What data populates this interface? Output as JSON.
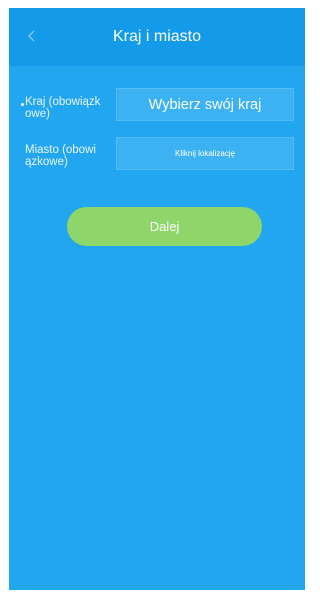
{
  "header": {
    "title": "Kraj i miasto",
    "back_icon": "chevron-left-icon"
  },
  "form": {
    "country": {
      "label_line1": "Kraj (obowiązk",
      "label_line2": "owe)",
      "value": "Wybierz swój kraj",
      "required": true
    },
    "city": {
      "label_line1": "Miasto (obowi",
      "label_line2": "ązkowe)",
      "value": "Kliknij lokalizację"
    }
  },
  "next_button": {
    "label": "Dalej"
  },
  "colors": {
    "background": "#22a6f0",
    "header": "#139be9",
    "button": "#8ed66a"
  }
}
